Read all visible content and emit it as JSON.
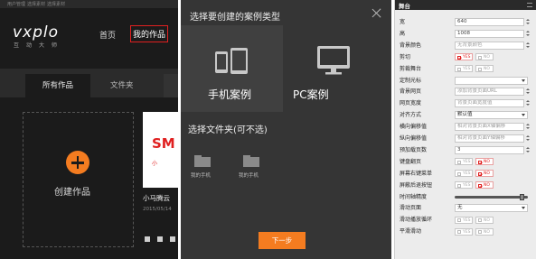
{
  "panel_dashboard": {
    "top_bar": [
      "用户管理",
      "选择素材",
      "选择素材"
    ],
    "logo": "vxplo",
    "logo_sub": "互动大师",
    "nav": {
      "home": "首页",
      "mine": "我的作品"
    },
    "tabs": {
      "all": "所有作品",
      "folder": "文件夹"
    },
    "create_label": "创建作品",
    "card": {
      "thumb_big": "SM",
      "thumb_small": "小",
      "title": "小马腾云",
      "date": "2015/05/14"
    }
  },
  "panel_modal": {
    "title": "选择要创建的案例类型",
    "mobile_label": "手机案例",
    "pc_label": "PC案例",
    "folder_title": "选择文件夹(可不选)",
    "folders": [
      "我的手机",
      "我的手机"
    ],
    "next_label": "下一步"
  },
  "panel_stage": {
    "title": "舞台",
    "rows": [
      {
        "label": "宽",
        "kind": "input",
        "value": "640"
      },
      {
        "label": "高",
        "kind": "input",
        "value": "1008"
      },
      {
        "label": "背景颜色",
        "kind": "input",
        "value": "无背景颜色",
        "placeholder": true
      },
      {
        "label": "剪切",
        "kind": "toggle",
        "yes": "YES",
        "no": "NO",
        "on": "yes"
      },
      {
        "label": "剪裁舞台",
        "kind": "toggle",
        "yes": "YES",
        "no": "NO",
        "on": "none"
      },
      {
        "label": "定制光标",
        "kind": "select",
        "value": ""
      },
      {
        "label": "背景网页",
        "kind": "input",
        "value": "添加背景页面URL",
        "placeholder": true
      },
      {
        "label": "网页宽度",
        "kind": "input",
        "value": "背景页面宽度值",
        "placeholder": true
      },
      {
        "label": "对齐方式",
        "kind": "select",
        "value": "默认值"
      },
      {
        "label": "横向偏移值",
        "kind": "input",
        "value": "相对背景页面X轴偏移",
        "placeholder": true
      },
      {
        "label": "纵向偏移值",
        "kind": "input",
        "value": "相对背景页面Y轴偏移",
        "placeholder": true
      },
      {
        "label": "预加载页数",
        "kind": "input",
        "value": "3"
      },
      {
        "label": "键盘翻页",
        "kind": "toggle",
        "yes": "YES",
        "no": "NO",
        "on": "no"
      },
      {
        "label": "屏幕右键菜单",
        "kind": "toggle",
        "yes": "YES",
        "no": "NO",
        "on": "no"
      },
      {
        "label": "屏蔽后退按钮",
        "kind": "toggle",
        "yes": "YES",
        "no": "NO",
        "on": "no"
      },
      {
        "label": "时间轴精度",
        "kind": "slider"
      },
      {
        "label": "滑动页面",
        "kind": "select",
        "value": "无"
      },
      {
        "label": "滑动播放循环",
        "kind": "toggle",
        "yes": "YES",
        "no": "NO",
        "on": "none"
      },
      {
        "label": "平滑滑动",
        "kind": "toggle",
        "yes": "YES",
        "no": "NO",
        "on": "none"
      }
    ],
    "slider_value": 0.92
  }
}
